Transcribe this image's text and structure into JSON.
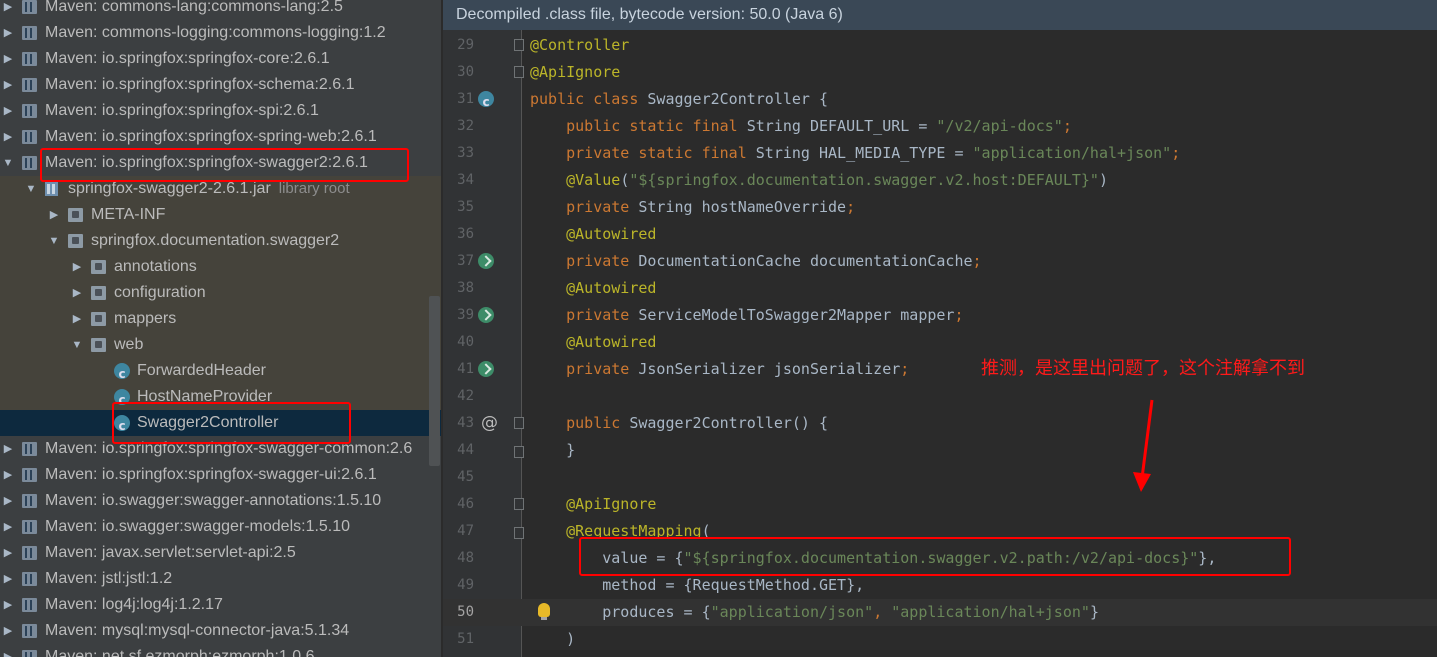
{
  "tree": {
    "items": [
      {
        "label": "Maven: commons-lang:commons-lang:2.5",
        "icon": "library-icon",
        "expanded": false
      },
      {
        "label": "Maven: commons-logging:commons-logging:1.2",
        "icon": "library-icon",
        "expanded": false
      },
      {
        "label": "Maven: io.springfox:springfox-core:2.6.1",
        "icon": "library-icon",
        "expanded": false
      },
      {
        "label": "Maven: io.springfox:springfox-schema:2.6.1",
        "icon": "library-icon",
        "expanded": false
      },
      {
        "label": "Maven: io.springfox:springfox-spi:2.6.1",
        "icon": "library-icon",
        "expanded": false
      },
      {
        "label": "Maven: io.springfox:springfox-spring-web:2.6.1",
        "icon": "library-icon",
        "expanded": false
      },
      {
        "label": "Maven: io.springfox:springfox-swagger2:2.6.1",
        "icon": "library-icon",
        "expanded": true
      },
      {
        "label": "springfox-swagger2-2.6.1.jar",
        "note": "library root",
        "icon": "jar-icon",
        "expanded": true
      },
      {
        "label": "META-INF",
        "icon": "package-icon",
        "expanded": false
      },
      {
        "label": "springfox.documentation.swagger2",
        "icon": "package-icon",
        "expanded": true
      },
      {
        "label": "annotations",
        "icon": "package-icon",
        "expanded": false
      },
      {
        "label": "configuration",
        "icon": "package-icon",
        "expanded": false
      },
      {
        "label": "mappers",
        "icon": "package-icon",
        "expanded": false
      },
      {
        "label": "web",
        "icon": "package-icon",
        "expanded": true
      },
      {
        "label": "ForwardedHeader",
        "icon": "class-icon"
      },
      {
        "label": "HostNameProvider",
        "icon": "class-icon"
      },
      {
        "label": "Swagger2Controller",
        "icon": "class-icon",
        "selected": true
      },
      {
        "label": "Maven: io.springfox:springfox-swagger-common:2.6",
        "icon": "library-icon",
        "expanded": false
      },
      {
        "label": "Maven: io.springfox:springfox-swagger-ui:2.6.1",
        "icon": "library-icon",
        "expanded": false
      },
      {
        "label": "Maven: io.swagger:swagger-annotations:1.5.10",
        "icon": "library-icon",
        "expanded": false
      },
      {
        "label": "Maven: io.swagger:swagger-models:1.5.10",
        "icon": "library-icon",
        "expanded": false
      },
      {
        "label": "Maven: javax.servlet:servlet-api:2.5",
        "icon": "library-icon",
        "expanded": false
      },
      {
        "label": "Maven: jstl:jstl:1.2",
        "icon": "library-icon",
        "expanded": false
      },
      {
        "label": "Maven: log4j:log4j:1.2.17",
        "icon": "library-icon",
        "expanded": false
      },
      {
        "label": "Maven: mysql:mysql-connector-java:5.1.34",
        "icon": "library-icon",
        "expanded": false
      },
      {
        "label": "Maven: net.sf.ezmorph:ezmorph:1.0.6",
        "icon": "library-icon",
        "expanded": false
      }
    ]
  },
  "editor": {
    "banner": "Decompiled .class file, bytecode version: 50.0 (Java 6)",
    "current_line": "50",
    "lines": [
      {
        "num": "29",
        "tokens": [
          {
            "t": "@Controller",
            "c": "ann"
          }
        ]
      },
      {
        "num": "30",
        "tokens": [
          {
            "t": "@ApiIgnore",
            "c": "ann"
          }
        ]
      },
      {
        "num": "31",
        "tokens": [
          {
            "t": "public class ",
            "c": "kw"
          },
          {
            "t": "Swagger2Controller {",
            "c": ""
          }
        ]
      },
      {
        "num": "32",
        "tokens": [
          {
            "t": "    public static final ",
            "c": "kw"
          },
          {
            "t": "String DEFAULT_URL = ",
            "c": ""
          },
          {
            "t": "\"/v2/api-docs\"",
            "c": "str"
          },
          {
            "t": ";",
            "c": "kw"
          }
        ]
      },
      {
        "num": "33",
        "tokens": [
          {
            "t": "    private static final ",
            "c": "kw"
          },
          {
            "t": "String HAL_MEDIA_TYPE = ",
            "c": ""
          },
          {
            "t": "\"application/hal+json\"",
            "c": "str"
          },
          {
            "t": ";",
            "c": "kw"
          }
        ]
      },
      {
        "num": "34",
        "tokens": [
          {
            "t": "    @Value",
            "c": "ann"
          },
          {
            "t": "(",
            "c": ""
          },
          {
            "t": "\"${springfox.documentation.swagger.v2.host:DEFAULT}\"",
            "c": "str"
          },
          {
            "t": ")",
            "c": ""
          }
        ]
      },
      {
        "num": "35",
        "tokens": [
          {
            "t": "    private ",
            "c": "kw"
          },
          {
            "t": "String hostNameOverride",
            "c": ""
          },
          {
            "t": ";",
            "c": "kw"
          }
        ]
      },
      {
        "num": "36",
        "tokens": [
          {
            "t": "    @Autowired",
            "c": "ann"
          }
        ]
      },
      {
        "num": "37",
        "tokens": [
          {
            "t": "    private ",
            "c": "kw"
          },
          {
            "t": "DocumentationCache documentationCache",
            "c": ""
          },
          {
            "t": ";",
            "c": "kw"
          }
        ]
      },
      {
        "num": "38",
        "tokens": [
          {
            "t": "    @Autowired",
            "c": "ann"
          }
        ]
      },
      {
        "num": "39",
        "tokens": [
          {
            "t": "    private ",
            "c": "kw"
          },
          {
            "t": "ServiceModelToSwagger2Mapper mapper",
            "c": ""
          },
          {
            "t": ";",
            "c": "kw"
          }
        ]
      },
      {
        "num": "40",
        "tokens": [
          {
            "t": "    @Autowired",
            "c": "ann"
          }
        ]
      },
      {
        "num": "41",
        "tokens": [
          {
            "t": "    private ",
            "c": "kw"
          },
          {
            "t": "JsonSerializer jsonSerializer",
            "c": ""
          },
          {
            "t": ";",
            "c": "kw"
          }
        ]
      },
      {
        "num": "42",
        "tokens": []
      },
      {
        "num": "43",
        "tokens": [
          {
            "t": "    public ",
            "c": "kw"
          },
          {
            "t": "Swagger2Controller() {",
            "c": ""
          }
        ]
      },
      {
        "num": "44",
        "tokens": [
          {
            "t": "    }",
            "c": ""
          }
        ]
      },
      {
        "num": "45",
        "tokens": []
      },
      {
        "num": "46",
        "tokens": [
          {
            "t": "    @ApiIgnore",
            "c": "ann"
          }
        ]
      },
      {
        "num": "47",
        "tokens": [
          {
            "t": "    @RequestMapping",
            "c": "ann"
          },
          {
            "t": "(",
            "c": ""
          }
        ]
      },
      {
        "num": "48",
        "tokens": [
          {
            "t": "        value = {",
            "c": ""
          },
          {
            "t": "\"${springfox.documentation.swagger.v2.path:/v2/api-docs}\"",
            "c": "str"
          },
          {
            "t": "},",
            "c": ""
          }
        ]
      },
      {
        "num": "49",
        "tokens": [
          {
            "t": "        method = {RequestMethod.GET},",
            "c": ""
          }
        ]
      },
      {
        "num": "50",
        "tokens": [
          {
            "t": "        produces = {",
            "c": ""
          },
          {
            "t": "\"application/json\"",
            "c": "str"
          },
          {
            "t": ", ",
            "c": "kw"
          },
          {
            "t": "\"application/hal+json\"",
            "c": "str"
          },
          {
            "t": "}",
            "c": ""
          }
        ]
      },
      {
        "num": "51",
        "tokens": [
          {
            "t": "    )",
            "c": ""
          }
        ]
      }
    ]
  },
  "annotation_note": "推测，是这里出问题了，这个注解拿不到",
  "colors": {
    "annotation_red": "#ff0000",
    "selection": "#0d293e",
    "keyword": "#cc7832",
    "string": "#6a8759",
    "annotation": "#bbb529"
  }
}
